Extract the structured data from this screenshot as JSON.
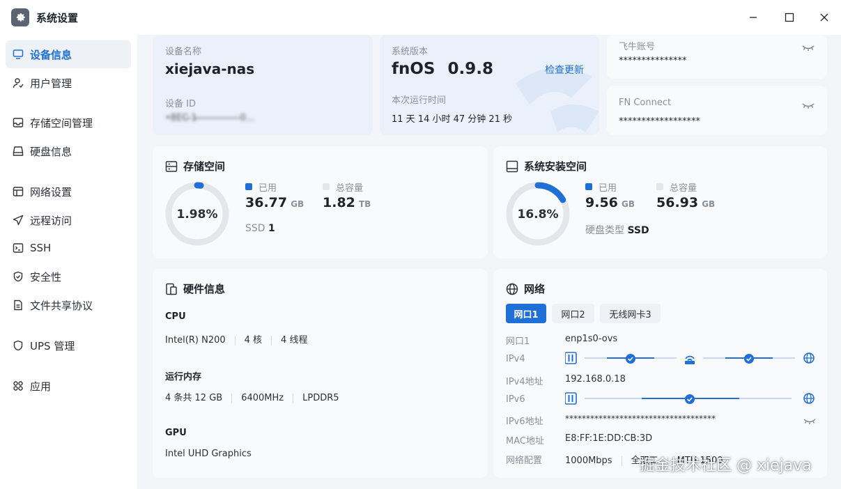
{
  "window": {
    "title": "系统设置"
  },
  "sidebar": {
    "items": [
      {
        "label": "设备信息",
        "icon": "monitor-icon",
        "active": true
      },
      {
        "label": "用户管理",
        "icon": "user-icon"
      },
      {
        "label": "存储空间管理",
        "icon": "storage-icon"
      },
      {
        "label": "硬盘信息",
        "icon": "disk-icon"
      },
      {
        "label": "网络设置",
        "icon": "network-icon"
      },
      {
        "label": "远程访问",
        "icon": "send-icon"
      },
      {
        "label": "SSH",
        "icon": "terminal-icon"
      },
      {
        "label": "安全性",
        "icon": "shield-icon"
      },
      {
        "label": "文件共享协议",
        "icon": "file-icon"
      },
      {
        "label": "UPS 管理",
        "icon": "ups-icon"
      },
      {
        "label": "应用",
        "icon": "apps-icon"
      }
    ]
  },
  "device": {
    "name_label": "设备名称",
    "name_value": "xiejava-nas",
    "id_label": "设备 ID",
    "id_value": "•8EC ̶1 ̶ ̶ ̶ ̶ ̶ ̶ ̶ ̶ ̶ ̶ ̶ ̶ ̶ ̶ ̶0...",
    "version_label": "系统版本",
    "version_os": "fnOS",
    "version_num": "0.9.8",
    "check_update": "检查更新",
    "uptime_label": "本次运行时间",
    "uptime_value": "11 天 14 小时 47 分钟 21 秒"
  },
  "account": {
    "label": "飞牛账号",
    "value": "***************"
  },
  "fn_connect": {
    "label": "FN Connect",
    "value": "******************"
  },
  "storage": {
    "title": "存储空间",
    "percent_text": "1.98%",
    "percent": 1.98,
    "used_label": "已用",
    "used_value": "36.77",
    "used_unit": "GB",
    "total_label": "总容量",
    "total_value": "1.82",
    "total_unit": "TB",
    "ssd_label": "SSD",
    "ssd_count": "1"
  },
  "sys_install": {
    "title": "系统安装空间",
    "percent_text": "16.8%",
    "percent": 16.8,
    "used_label": "已用",
    "used_value": "9.56",
    "used_unit": "GB",
    "total_label": "总容量",
    "total_value": "56.93",
    "total_unit": "GB",
    "disk_type_label": "硬盘类型",
    "disk_type_value": "SSD"
  },
  "hardware": {
    "title": "硬件信息",
    "cpu_label": "CPU",
    "cpu_model": "Intel(R) N200",
    "cpu_cores": "4 核",
    "cpu_threads": "4 线程",
    "mem_label": "运行内存",
    "mem_size": "4 条共 12 GB",
    "mem_speed": "6400MHz",
    "mem_type": "LPDDR5",
    "gpu_label": "GPU",
    "gpu_model": "Intel UHD Graphics"
  },
  "network": {
    "title": "网络",
    "tabs": [
      "网口1",
      "网口2",
      "无线网卡3"
    ],
    "port_label": "网口1",
    "port_value": "enp1s0-ovs",
    "ipv4_label": "IPv4",
    "ipv4_addr_label": "IPv4地址",
    "ipv4_addr_value": "192.168.0.18",
    "ipv6_label": "IPv6",
    "ipv6_addr_label": "IPv6地址",
    "ipv6_addr_value": "************************************",
    "mac_label": "MAC地址",
    "mac_value": "E8:FF:1E:DD:CB:3D",
    "config_label": "网络配置",
    "config_speed": "1000Mbps",
    "config_duplex": "全双工",
    "config_mtu": "MTU 1500"
  },
  "watermark": "掘金技术社区 @ xiejava",
  "colors": {
    "accent": "#1f6fd6",
    "ring_track": "#e3e6eb"
  }
}
